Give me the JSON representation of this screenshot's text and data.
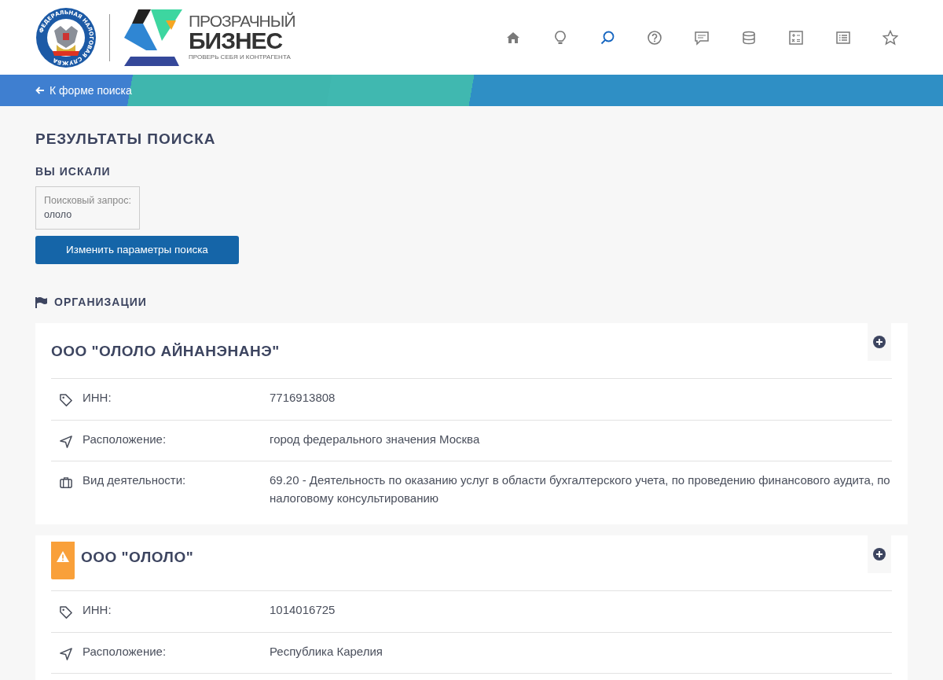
{
  "header": {
    "emblem_text": "ФЕДЕРАЛЬНАЯ НАЛОГОВАЯ СЛУЖБА",
    "brand": {
      "line1": "ПРОЗРАЧНЫЙ",
      "line2": "БИЗНЕС",
      "tagline": "ПРОВЕРЬ СЕБЯ И КОНТРАГЕНТА"
    },
    "nav": [
      {
        "kind": "home",
        "selected": false
      },
      {
        "kind": "idea",
        "selected": false
      },
      {
        "kind": "search",
        "selected": true
      },
      {
        "kind": "help",
        "selected": false
      },
      {
        "kind": "chat",
        "selected": false
      },
      {
        "kind": "database",
        "selected": false
      },
      {
        "kind": "calculator",
        "selected": false
      },
      {
        "kind": "list",
        "selected": false
      },
      {
        "kind": "star",
        "selected": false
      }
    ]
  },
  "back_link": "К форме поиска",
  "title": "РЕЗУЛЬТАТЫ ПОИСКА",
  "query": {
    "heading": "ВЫ ИСКАЛИ",
    "label": "Поисковый запрос:",
    "value": "ололо"
  },
  "change_button": "Изменить параметры поиска",
  "section": "ОРГАНИЗАЦИИ",
  "organizations": [
    {
      "name": "ООО \"ОЛОЛО АЙНАНЭНАНЭ\"",
      "warning": false,
      "fields": [
        {
          "kind": "tag",
          "label": "ИНН:",
          "value": "7716913808"
        },
        {
          "kind": "location",
          "label": "Расположение:",
          "value": "город федерального значения Москва"
        },
        {
          "kind": "activity",
          "label": "Вид деятельности:",
          "value": "69.20 - Деятельность по оказанию услуг в области бухгалтерского учета, по проведению финансового аудита, по налоговому консультированию"
        }
      ]
    },
    {
      "name": "ООО \"ОЛОЛО\"",
      "warning": true,
      "fields": [
        {
          "kind": "tag",
          "label": "ИНН:",
          "value": "1014016725"
        },
        {
          "kind": "location",
          "label": "Расположение:",
          "value": "Республика Карелия"
        }
      ]
    }
  ]
}
